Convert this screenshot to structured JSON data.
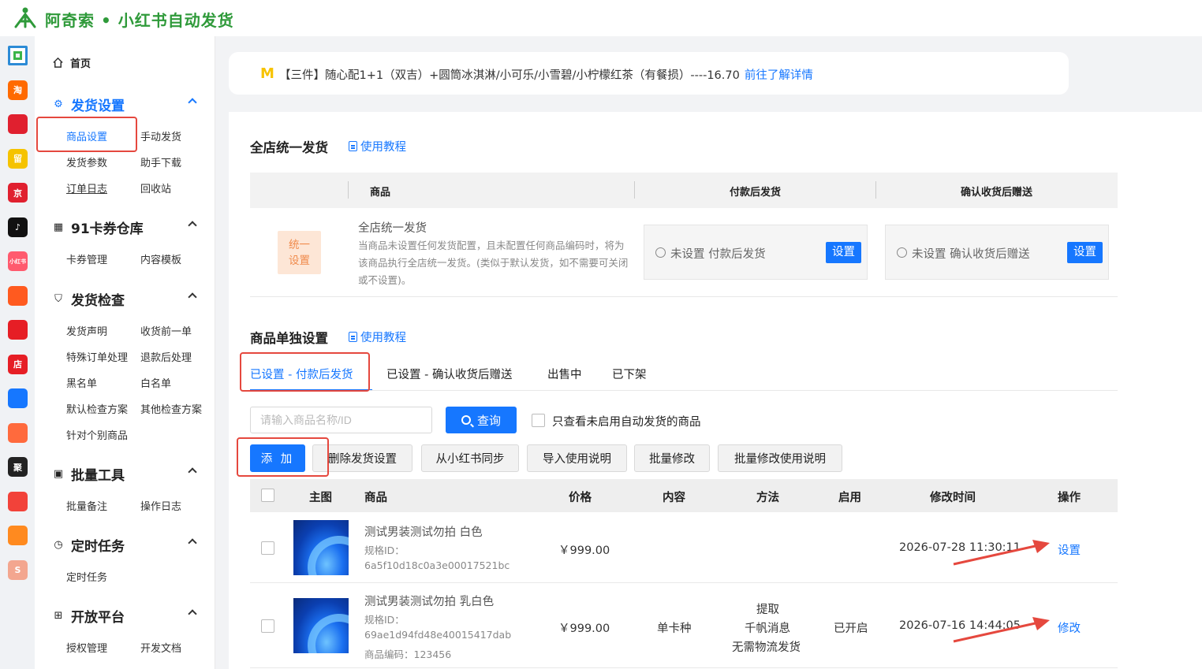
{
  "app": {
    "title": "阿奇索 • 小红书自动发货"
  },
  "rail": [
    {
      "icon": "grid-app-icon",
      "label": "",
      "color": "#ffffff"
    },
    {
      "icon": "taobao-icon",
      "label": "淘",
      "color": "#ff6a00"
    },
    {
      "icon": "tmall-icon",
      "label": "",
      "color": "#e0202f"
    },
    {
      "icon": "liuliu-icon",
      "label": "留",
      "color": "#f5c300"
    },
    {
      "icon": "jd-icon",
      "label": "京",
      "color": "#e0202f"
    },
    {
      "icon": "douyin-icon",
      "label": "♪",
      "color": "#111111"
    },
    {
      "icon": "xiaohongshu-icon",
      "label": "小红书",
      "color": "#ff5a6e"
    },
    {
      "icon": "kuaishou-icon",
      "label": "",
      "color": "#ff5a1f"
    },
    {
      "icon": "thumb-icon",
      "label": "",
      "color": "#e61e25"
    },
    {
      "icon": "store-icon",
      "label": "店",
      "color": "#e61e25"
    },
    {
      "icon": "link-icon",
      "label": "",
      "color": "#1677ff"
    },
    {
      "icon": "shop-icon",
      "label": "",
      "color": "#ff6a3d"
    },
    {
      "icon": "kuaimai-icon",
      "label": "聚",
      "color": "#222222"
    },
    {
      "icon": "bag-icon",
      "label": "",
      "color": "#f2423a"
    },
    {
      "icon": "orange-icon",
      "label": "",
      "color": "#ff8a1f"
    },
    {
      "icon": "shopee-icon",
      "label": "S",
      "color": "#f3a68f"
    }
  ],
  "sidebar": {
    "home": "首页",
    "groups": [
      {
        "title": "发货设置",
        "items": [
          "商品设置",
          "手动发货",
          "发货参数",
          "助手下载",
          "订单日志",
          "回收站"
        ]
      },
      {
        "title": "91卡券仓库",
        "items": [
          "卡券管理",
          "内容模板"
        ]
      },
      {
        "title": "发货检查",
        "items": [
          "发货声明",
          "收货前一单",
          "特殊订单处理",
          "退款后处理",
          "黑名单",
          "白名单",
          "默认检查方案",
          "其他检查方案",
          "针对个别商品"
        ]
      },
      {
        "title": "批量工具",
        "items": [
          "批量备注",
          "操作日志"
        ]
      },
      {
        "title": "定时任务",
        "items": [
          "定时任务"
        ]
      },
      {
        "title": "开放平台",
        "items": [
          "授权管理",
          "开发文档"
        ]
      }
    ]
  },
  "notice": {
    "text": "【三件】随心配1+1（双吉）+圆筒冰淇淋/小可乐/小雪碧/小柠檬红茶（有餐损）----16.70",
    "link": "前往了解详情"
  },
  "unified": {
    "title": "全店统一发货",
    "tutorial": "使用教程",
    "headers": [
      "商品",
      "付款后发货",
      "确认收货后赠送"
    ],
    "badge_line1": "统一",
    "badge_line2": "设置",
    "row_title": "全店统一发货",
    "row_desc": "当商品未设置任何发货配置，且未配置任何商品编码时，将为该商品执行全店统一发货。(类似于默认发货，如不需要可关闭或不设置)。",
    "pay_status": "未设置 付款后发货",
    "confirm_status": "未设置 确认收货后赠送",
    "set_btn": "设置"
  },
  "single": {
    "title": "商品单独设置",
    "tutorial": "使用教程",
    "tabs": [
      "已设置 - 付款后发货",
      "已设置 - 确认收货后赠送",
      "出售中",
      "已下架"
    ],
    "search_placeholder": "请输入商品名称/ID",
    "query_btn": "查询",
    "only_unenabled": "只查看未启用自动发货的商品",
    "actions": [
      "添 加",
      "删除发货设置",
      "从小红书同步",
      "导入使用说明",
      "批量修改",
      "批量修改使用说明"
    ],
    "columns": [
      "主图",
      "商品",
      "价格",
      "内容",
      "方法",
      "启用",
      "修改时间",
      "操作"
    ],
    "rows": [
      {
        "name": "测试男装测试勿拍 白色",
        "spec_label": "规格ID：",
        "spec_id": "6a5f10d18c0a3e00017521bc",
        "code": "",
        "price": "￥999.00",
        "content": "",
        "method": [
          "",
          "",
          ""
        ],
        "enabled": "",
        "time": "2026-07-28 11:30:11",
        "op": "设置"
      },
      {
        "name": "测试男装测试勿拍 乳白色",
        "spec_label": "规格ID：",
        "spec_id": "69ae1d94fd48e40015417dab",
        "code": "商品编码：123456",
        "price": "￥999.00",
        "content": "单卡种",
        "method": [
          "提取",
          "千帆消息",
          "无需物流发货"
        ],
        "enabled": "已开启",
        "time": "2026-07-16 14:44:05",
        "op": "修改"
      }
    ]
  }
}
